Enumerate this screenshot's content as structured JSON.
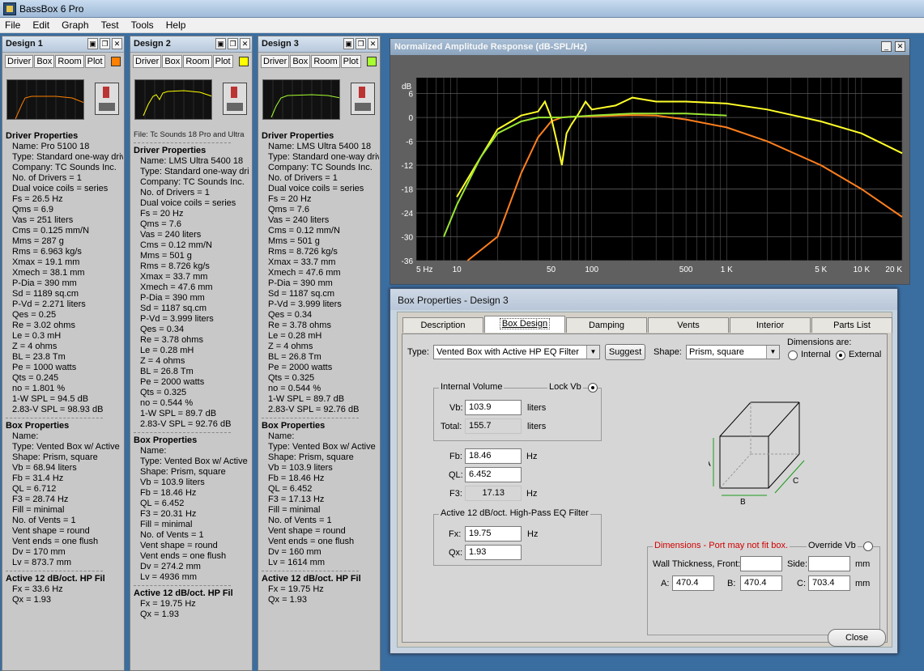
{
  "app": {
    "title": "BassBox 6 Pro"
  },
  "menu": [
    "File",
    "Edit",
    "Graph",
    "Test",
    "Tools",
    "Help"
  ],
  "designs": [
    {
      "title": "Design 1",
      "tabs": [
        "Driver",
        "Box",
        "Room",
        "Plot"
      ],
      "plot_color": "#ff8000",
      "file_line": "",
      "driver_heading": "Driver Properties",
      "driver_lines": [
        "Name: Pro 5100 18",
        "Type: Standard one-way driv",
        "Company: TC Sounds Inc.",
        "No. of Drivers = 1",
        "Dual voice coils = series",
        "Fs = 26.5 Hz",
        "Qms = 6.9",
        "Vas = 251 liters",
        "Cms = 0.125 mm/N",
        "Mms = 287 g",
        "Rms = 6.963 kg/s",
        "Xmax = 19.1 mm",
        "Xmech = 38.1 mm",
        "P-Dia = 390 mm",
        "Sd = 1189 sq.cm",
        "P-Vd = 2.271 liters",
        "Qes = 0.25",
        "Re = 3.02 ohms",
        "Le = 0.3 mH",
        "Z = 4 ohms",
        "BL = 23.8 Tm",
        "Pe = 1000 watts",
        "Qts = 0.245",
        "no = 1.801 %",
        "1-W SPL = 94.5 dB",
        "2.83-V SPL = 98.93 dB"
      ],
      "box_heading": "Box Properties",
      "box_lines": [
        "Name:",
        "Type: Vented Box w/ Active",
        "Shape: Prism, square",
        "Vb = 68.94 liters",
        "Fb = 31.4 Hz",
        "QL = 6.712",
        "F3 = 28.74 Hz",
        "Fill = minimal",
        "No. of Vents = 1",
        "Vent shape = round",
        "Vent ends = one flush",
        "Dv = 170 mm",
        "Lv = 873.7 mm"
      ],
      "hp_heading": "Active 12 dB/oct. HP Fil",
      "hp_lines": [
        "Fx = 33.6 Hz",
        "Qx = 1.93"
      ]
    },
    {
      "title": "Design 2",
      "tabs": [
        "Driver",
        "Box",
        "Room",
        "Plot"
      ],
      "plot_color": "#ffff00",
      "file_line": "File: Tc Sounds 18 Pro and Ultra",
      "driver_heading": "Driver Properties",
      "driver_lines": [
        "Name: LMS Ultra 5400 18",
        "Type: Standard one-way dri",
        "Company: TC Sounds Inc.",
        "No. of Drivers = 1",
        "Dual voice coils = series",
        "Fs = 20 Hz",
        "Qms = 7.6",
        "Vas = 240 liters",
        "Cms = 0.12 mm/N",
        "Mms = 501 g",
        "Rms = 8.726 kg/s",
        "Xmax = 33.7 mm",
        "Xmech = 47.6 mm",
        "P-Dia = 390 mm",
        "Sd = 1187 sq.cm",
        "P-Vd = 3.999 liters",
        "Qes = 0.34",
        "Re = 3.78 ohms",
        "Le = 0.28 mH",
        "Z = 4 ohms",
        "BL = 26.8 Tm",
        "Pe = 2000 watts",
        "Qts = 0.325",
        "no = 0.544 %",
        "1-W SPL = 89.7 dB",
        "2.83-V SPL = 92.76 dB"
      ],
      "box_heading": "Box Properties",
      "box_lines": [
        "Name:",
        "Type: Vented Box w/ Active",
        "Shape: Prism, square",
        "Vb = 103.9 liters",
        "Fb = 18.46 Hz",
        "QL = 6.452",
        "F3 = 20.31 Hz",
        "Fill = minimal",
        "No. of Vents = 1",
        "Vent shape = round",
        "Vent ends = one flush",
        "Dv = 274.2 mm",
        "Lv = 4936 mm"
      ],
      "hp_heading": "Active 12 dB/oct. HP Fil",
      "hp_lines": [
        "Fx = 19.75 Hz",
        "Qx = 1.93"
      ]
    },
    {
      "title": "Design 3",
      "tabs": [
        "Driver",
        "Box",
        "Room",
        "Plot"
      ],
      "plot_color": "#a8ff30",
      "file_line": "",
      "driver_heading": "Driver Properties",
      "driver_lines": [
        "Name: LMS Ultra 5400 18",
        "Type: Standard one-way driv",
        "Company: TC Sounds Inc.",
        "No. of Drivers = 1",
        "Dual voice coils = series",
        "Fs = 20 Hz",
        "Qms = 7.6",
        "Vas = 240 liters",
        "Cms = 0.12 mm/N",
        "Mms = 501 g",
        "Rms = 8.726 kg/s",
        "Xmax = 33.7 mm",
        "Xmech = 47.6 mm",
        "P-Dia = 390 mm",
        "Sd = 1187 sq.cm",
        "P-Vd = 3.999 liters",
        "Qes = 0.34",
        "Re = 3.78 ohms",
        "Le = 0.28 mH",
        "Z = 4 ohms",
        "BL = 26.8 Tm",
        "Pe = 2000 watts",
        "Qts = 0.325",
        "no = 0.544 %",
        "1-W SPL = 89.7 dB",
        "2.83-V SPL = 92.76 dB"
      ],
      "box_heading": "Box Properties",
      "box_lines": [
        "Name:",
        "Type: Vented Box w/ Active",
        "Shape: Prism, square",
        "Vb = 103.9 liters",
        "Fb = 18.46 Hz",
        "QL = 6.452",
        "F3 = 17.13 Hz",
        "Fill = minimal",
        "No. of Vents = 1",
        "Vent shape = round",
        "Vent ends = one flush",
        "Dv = 160 mm",
        "Lv = 1614 mm"
      ],
      "hp_heading": "Active 12 dB/oct. HP Fil",
      "hp_lines": [
        "Fx = 19.75 Hz",
        "Qx = 1.93"
      ]
    }
  ],
  "graph": {
    "title": "Normalized Amplitude Response (dB-SPL/Hz)",
    "ylabel": "dB",
    "yticks": [
      "6",
      "0",
      "-6",
      "-12",
      "-18",
      "-24",
      "-30",
      "-36"
    ],
    "xticks": [
      "5 Hz",
      "10",
      "50",
      "100",
      "500",
      "1 K",
      "5 K",
      "10 K",
      "20 K"
    ],
    "series": [
      {
        "color": "#ff7f1e",
        "points": [
          [
            12,
            -40
          ],
          [
            20,
            -30
          ],
          [
            30,
            -14
          ],
          [
            40,
            -5
          ],
          [
            50,
            -1
          ],
          [
            60,
            0
          ],
          [
            70,
            0.2
          ],
          [
            100,
            0.3
          ],
          [
            200,
            0.6
          ],
          [
            300,
            0.5
          ],
          [
            500,
            -0.5
          ],
          [
            1000,
            -2.5
          ],
          [
            2000,
            -6
          ],
          [
            5000,
            -12
          ],
          [
            10000,
            -18
          ],
          [
            20000,
            -25
          ]
        ]
      },
      {
        "color": "#ffff2a",
        "points": [
          [
            10,
            -20
          ],
          [
            15,
            -10
          ],
          [
            20,
            -3
          ],
          [
            30,
            0.5
          ],
          [
            40,
            1.5
          ],
          [
            45,
            4
          ],
          [
            50,
            0
          ],
          [
            55,
            -6
          ],
          [
            60,
            -12
          ],
          [
            65,
            -4
          ],
          [
            70,
            -2
          ],
          [
            80,
            1
          ],
          [
            90,
            4
          ],
          [
            100,
            2
          ],
          [
            150,
            3
          ],
          [
            200,
            5
          ],
          [
            300,
            4
          ],
          [
            500,
            4
          ],
          [
            1000,
            3.5
          ],
          [
            2000,
            2
          ],
          [
            5000,
            -1
          ],
          [
            10000,
            -4
          ],
          [
            20000,
            -9
          ]
        ]
      },
      {
        "color": "#9ae632",
        "points": [
          [
            8,
            -30
          ],
          [
            10,
            -22
          ],
          [
            15,
            -10
          ],
          [
            20,
            -4
          ],
          [
            30,
            -1
          ],
          [
            40,
            0
          ],
          [
            60,
            0
          ],
          [
            100,
            0.5
          ],
          [
            200,
            1
          ],
          [
            500,
            1
          ],
          [
            1000,
            0.5
          ]
        ]
      }
    ]
  },
  "boxprops": {
    "title": "Box Properties - Design 3",
    "tabs": [
      "Description",
      "Box Design",
      "Damping",
      "Vents",
      "Interior",
      "Parts List"
    ],
    "active_tab": "Box Design",
    "type_label": "Type:",
    "type_value": "Vented Box with Active HP EQ Filter",
    "suggest_label": "Suggest",
    "shape_label": "Shape:",
    "shape_value": "Prism, square",
    "dims_label": "Dimensions are:",
    "internal_label": "Internal",
    "external_label": "External",
    "dims_selected": "External",
    "iv_group": "Internal Volume",
    "lock_label": "Lock Vb",
    "vb_label": "Vb:",
    "vb_value": "103.9",
    "vb_unit": "liters",
    "total_label": "Total:",
    "total_value": "155.7",
    "total_unit": "liters",
    "fb_label": "Fb:",
    "fb_value": "18.46",
    "fb_unit": "Hz",
    "ql_label": "QL:",
    "ql_value": "6.452",
    "f3_label": "F3:",
    "f3_value": "17.13",
    "f3_unit": "Hz",
    "hp_group": "Active 12 dB/oct. High-Pass EQ Filter",
    "fx_label": "Fx:",
    "fx_value": "19.75",
    "fx_unit": "Hz",
    "qx_label": "Qx:",
    "qx_value": "1.93",
    "dim_group": "Dimensions - Port may not fit box.",
    "dim_warning_color": "#d00000",
    "override_label": "Override Vb",
    "wall_label": "Wall Thickness, Front:",
    "side_label": "Side:",
    "mm1": "mm",
    "a_label": "A:",
    "a_value": "470.4",
    "b_label": "B:",
    "b_value": "470.4",
    "c_label": "C:",
    "c_value": "703.4",
    "mm2": "mm",
    "diagram_a": "A",
    "diagram_b": "B",
    "diagram_c": "C",
    "close_label": "Close"
  }
}
